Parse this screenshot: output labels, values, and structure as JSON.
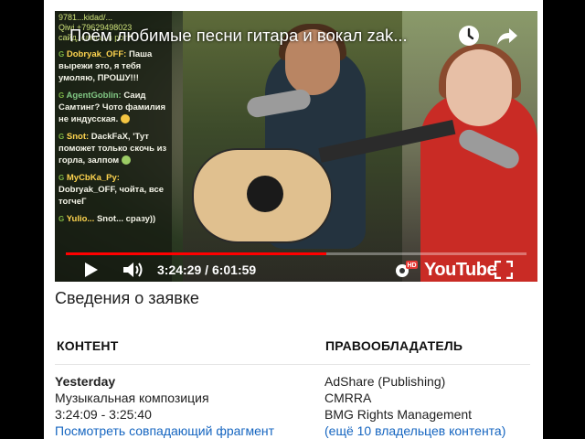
{
  "player": {
    "title": "Поём любимые песни гитара и вокал zak...",
    "current_time": "3:24:29",
    "duration": "6:01:59",
    "time_separator": "/",
    "progress": 0.565,
    "logo_text": "YouTube",
    "hd_badge": "HD",
    "accent_color": "#ff0000"
  },
  "chat": {
    "header_lines": [
      "9781...kidad/...",
      "Qiwi +79629498023",
      "сайд, самсы в рот?"
    ],
    "messages": [
      {
        "badge": "G",
        "user": "Dobryak_OFF:",
        "text": "Паша вырежи это, я тебя умоляю, ПРОШУ!!!"
      },
      {
        "badge": "G",
        "user": "AgentGoblin:",
        "text": "Саид Самтинг? Чото фамилия не индусская."
      },
      {
        "badge": "G",
        "user": "Snot:",
        "text": "DackFaX, 'Тут поможет только скочь из горла, залпом"
      },
      {
        "badge": "G",
        "user": "MyCbKa_Py:",
        "text": "Dobryak_OFF, чойта, все тогчеГ"
      },
      {
        "badge": "G",
        "user": "Yulio...",
        "text": "Snot... сразу))"
      }
    ]
  },
  "info": {
    "heading": "Сведения о заявке",
    "content_header": "КОНТЕНТ",
    "owner_header": "ПРАВООБЛАДАТЕЛЬ",
    "content_date": "Yesterday",
    "content_type": "Музыкальная композиция",
    "content_range": "3:24:09 - 3:25:40",
    "content_link": "Посмотреть совпадающий фрагмент",
    "owners": [
      "AdShare (Publishing)",
      "CMRRA",
      "BMG Rights Management"
    ],
    "owners_more": "(ещё 10 владельцев контента)"
  }
}
